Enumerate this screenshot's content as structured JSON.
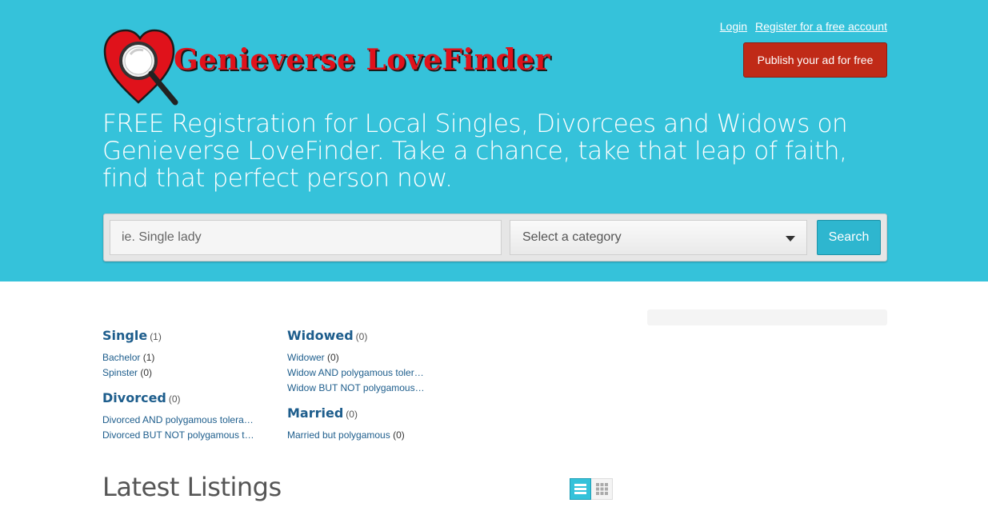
{
  "header": {
    "logo_text": "Genieverse LoveFinder",
    "login_label": "Login",
    "register_label": "Register for a free account",
    "publish_label": "Publish your ad for free",
    "tagline": "FREE Registration for Local Singles, Divorcees and Widows on Genieverse LoveFinder. Take a chance, take that leap of faith, find that perfect person now."
  },
  "search": {
    "placeholder": "ie. Single lady",
    "category_placeholder": "Select a category",
    "button_label": "Search"
  },
  "categories": [
    {
      "title": "Single",
      "count": "(1)",
      "subs": [
        {
          "label": "Bachelor",
          "count": "(1)"
        },
        {
          "label": "Spinster",
          "count": "(0)"
        }
      ]
    },
    {
      "title": "Divorced",
      "count": "(0)",
      "subs": [
        {
          "label": "Divorced AND polygamous tolera…",
          "count": ""
        },
        {
          "label": "Divorced BUT NOT polygamous t…",
          "count": ""
        }
      ]
    },
    {
      "title": "Widowed",
      "count": "(0)",
      "subs": [
        {
          "label": "Widower",
          "count": "(0)"
        },
        {
          "label": "Widow AND polygamous toler…",
          "count": ""
        },
        {
          "label": "Widow BUT NOT polygamous…",
          "count": ""
        }
      ]
    },
    {
      "title": "Married",
      "count": "(0)",
      "subs": [
        {
          "label": "Married but polygamous",
          "count": "(0)"
        }
      ]
    }
  ],
  "listings": {
    "heading": "Latest Listings",
    "view_list_icon": "list-view-icon",
    "view_grid_icon": "grid-view-icon"
  },
  "colors": {
    "hero_bg": "#35c2da",
    "publish_btn": "#c02a17",
    "link": "#1d5d8c",
    "logo_red": "#e0121b"
  }
}
